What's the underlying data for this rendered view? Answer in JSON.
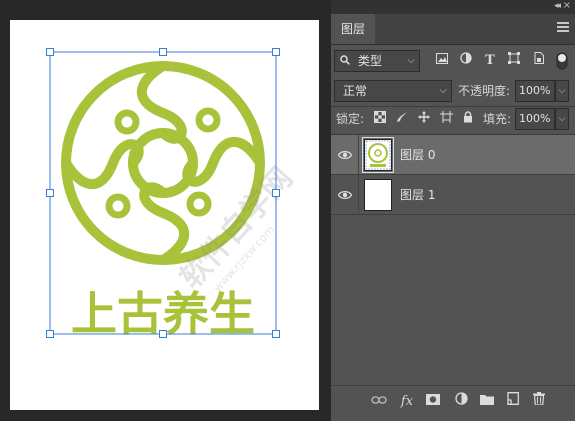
{
  "canvas": {
    "logo_text": "上古养生",
    "watermark_text": "软件自学网",
    "watermark_url": "www.rjzxw.com",
    "colors": {
      "logo": "#a8c23a",
      "selection": "#3b7ed8",
      "page": "#ffffff"
    }
  },
  "panel": {
    "tab_label": "图层",
    "filter": {
      "kind_label": "类型",
      "icons": [
        "image-filter-icon",
        "adjustment-filter-icon",
        "type-filter-icon",
        "shape-filter-icon",
        "smart-object-filter-icon"
      ]
    },
    "blend_mode": "正常",
    "opacity_label": "不透明度:",
    "opacity_value": "100%",
    "lock_label": "锁定:",
    "fill_label": "填充:",
    "fill_value": "100%",
    "layers": [
      {
        "name": "图层 0",
        "selected": true
      },
      {
        "name": "图层 1",
        "selected": false
      }
    ],
    "bottom_icons": [
      "link-icon",
      "fx-icon",
      "mask-icon",
      "adjustment-icon",
      "folder-icon",
      "new-layer-icon",
      "trash-icon"
    ],
    "fx_label": "fx"
  }
}
